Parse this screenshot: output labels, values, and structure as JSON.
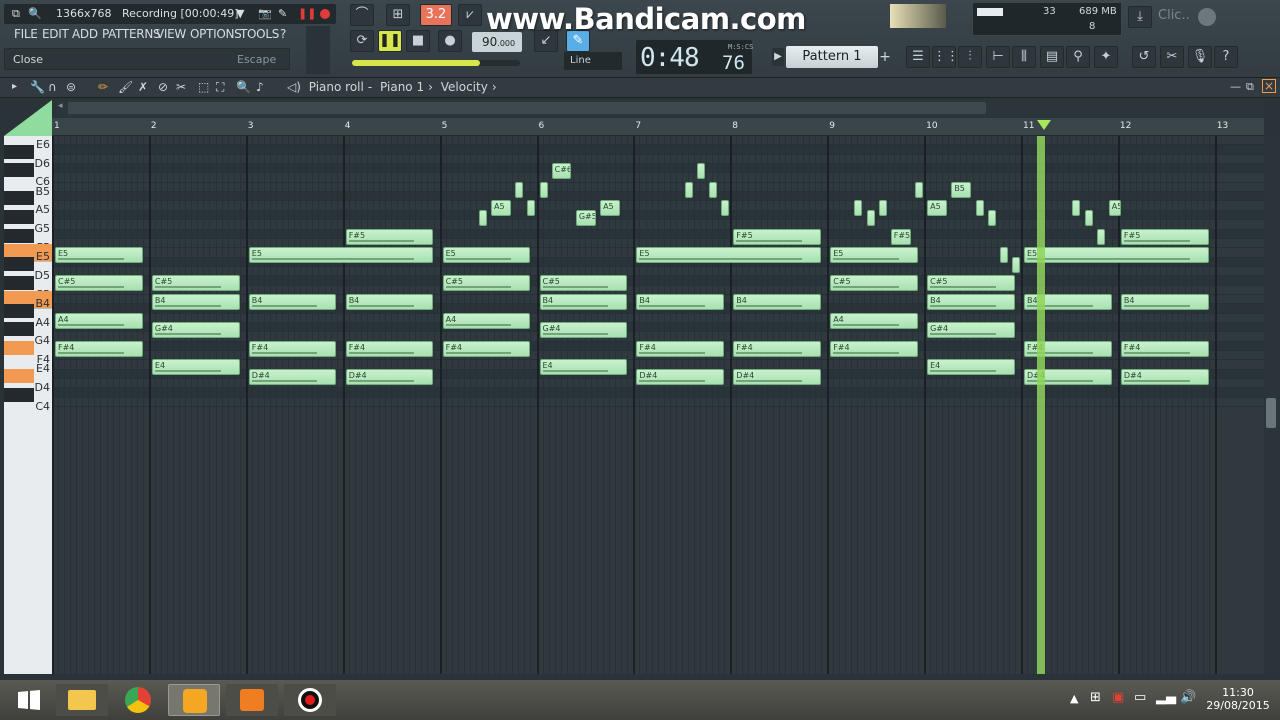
{
  "recorder": {
    "resolution": "1366x768",
    "status": "Recording [00:00:49]"
  },
  "watermark": "www.Bandicam.com",
  "menu": [
    "FILE",
    "EDIT",
    "ADD",
    "PATTERNS",
    "VIEW",
    "OPTIONS",
    "TOOLS",
    "?"
  ],
  "hint": {
    "left": "Close",
    "right": "Escape"
  },
  "transport": {
    "tempo_int": "90",
    "tempo_dec": ".000",
    "time_main": "0:48",
    "time_sub": "76",
    "time_label": "M:S:CS",
    "snap": "Line",
    "counter": "3.2"
  },
  "pattern": {
    "name": "Pattern 1"
  },
  "resources": {
    "cpu_num": "33",
    "memory": "689 MB",
    "polyphony": "8"
  },
  "clic_label": "Clic..",
  "piano_roll": {
    "crumbs": [
      "Piano roll",
      "Piano 1",
      "Velocity"
    ]
  },
  "ruler": [
    "1",
    "2",
    "3",
    "4",
    "5",
    "6",
    "7",
    "8",
    "9",
    "10",
    "11",
    "12",
    "13"
  ],
  "key_labels": [
    "E6",
    "D6",
    "C6",
    "B5",
    "A5",
    "G5",
    "F5",
    "E5",
    "D5",
    "C5",
    "B4",
    "A4",
    "G4",
    "F4",
    "E4",
    "D4",
    "C4"
  ],
  "notes": [
    {
      "label": "E5",
      "row": "E5",
      "bar": 1,
      "beat": 0,
      "len": 3.7
    },
    {
      "label": "C#5",
      "row": "C#5",
      "bar": 1,
      "beat": 0,
      "len": 3.7
    },
    {
      "label": "A4",
      "row": "A4",
      "bar": 1,
      "beat": 0,
      "len": 3.7
    },
    {
      "label": "F#4",
      "row": "F#4",
      "bar": 1,
      "beat": 0,
      "len": 3.7
    },
    {
      "label": "C#5",
      "row": "C#5",
      "bar": 2,
      "beat": 0,
      "len": 3.7
    },
    {
      "label": "B4",
      "row": "B4",
      "bar": 2,
      "beat": 0,
      "len": 3.7
    },
    {
      "label": "G#4",
      "row": "G#4",
      "bar": 2,
      "beat": 0,
      "len": 3.7
    },
    {
      "label": "E4",
      "row": "E4",
      "bar": 2,
      "beat": 0,
      "len": 3.7
    },
    {
      "label": "E5",
      "row": "E5",
      "bar": 3,
      "beat": 0,
      "len": 7.7
    },
    {
      "label": "B4",
      "row": "B4",
      "bar": 3,
      "beat": 0,
      "len": 3.7
    },
    {
      "label": "F#4",
      "row": "F#4",
      "bar": 3,
      "beat": 0,
      "len": 3.7
    },
    {
      "label": "D#4",
      "row": "D#4",
      "bar": 3,
      "beat": 0,
      "len": 3.7
    },
    {
      "label": "F#5",
      "row": "F#5",
      "bar": 4,
      "beat": 0,
      "len": 3.7
    },
    {
      "label": "B4",
      "row": "B4",
      "bar": 4,
      "beat": 0,
      "len": 3.7
    },
    {
      "label": "F#4",
      "row": "F#4",
      "bar": 4,
      "beat": 0,
      "len": 3.7
    },
    {
      "label": "D#4",
      "row": "D#4",
      "bar": 4,
      "beat": 0,
      "len": 3.7
    },
    {
      "label": "E5",
      "row": "E5",
      "bar": 5,
      "beat": 0,
      "len": 3.7
    },
    {
      "label": "C#5",
      "row": "C#5",
      "bar": 5,
      "beat": 0,
      "len": 3.7
    },
    {
      "label": "A4",
      "row": "A4",
      "bar": 5,
      "beat": 0,
      "len": 3.7
    },
    {
      "label": "F#4",
      "row": "F#4",
      "bar": 5,
      "beat": 0,
      "len": 3.7
    },
    {
      "label": "",
      "row": "G#5",
      "bar": 5,
      "beat": 1.5,
      "len": 0.4
    },
    {
      "label": "A5",
      "row": "A5",
      "bar": 5,
      "beat": 2,
      "len": 0.9
    },
    {
      "label": "",
      "row": "B5",
      "bar": 5,
      "beat": 3,
      "len": 0.4
    },
    {
      "label": "",
      "row": "A5",
      "bar": 5,
      "beat": 3.5,
      "len": 0.4
    },
    {
      "label": "",
      "row": "B5",
      "bar": 6,
      "beat": 0,
      "len": 0.4
    },
    {
      "label": "C#5",
      "row": "C#5",
      "bar": 6,
      "beat": 0,
      "len": 3.7
    },
    {
      "label": "B4",
      "row": "B4",
      "bar": 6,
      "beat": 0,
      "len": 3.7
    },
    {
      "label": "G#4",
      "row": "G#4",
      "bar": 6,
      "beat": 0,
      "len": 3.7
    },
    {
      "label": "E4",
      "row": "E4",
      "bar": 6,
      "beat": 0,
      "len": 3.7
    },
    {
      "label": "C#6",
      "row": "C#6",
      "bar": 6,
      "beat": 0.5,
      "len": 0.9
    },
    {
      "label": "G#5",
      "row": "G#5",
      "bar": 6,
      "beat": 1.5,
      "len": 0.9
    },
    {
      "label": "A5",
      "row": "A5",
      "bar": 6,
      "beat": 2.5,
      "len": 0.9
    },
    {
      "label": "E5",
      "row": "E5",
      "bar": 7,
      "beat": 0,
      "len": 7.7
    },
    {
      "label": "B4",
      "row": "B4",
      "bar": 7,
      "beat": 0,
      "len": 3.7
    },
    {
      "label": "F#4",
      "row": "F#4",
      "bar": 7,
      "beat": 0,
      "len": 3.7
    },
    {
      "label": "D#4",
      "row": "D#4",
      "bar": 7,
      "beat": 0,
      "len": 3.7
    },
    {
      "label": "",
      "row": "B5",
      "bar": 7,
      "beat": 2,
      "len": 0.4
    },
    {
      "label": "",
      "row": "C#6",
      "bar": 7,
      "beat": 2.5,
      "len": 0.4
    },
    {
      "label": "",
      "row": "B5",
      "bar": 7,
      "beat": 3,
      "len": 0.4
    },
    {
      "label": "",
      "row": "A5",
      "bar": 7,
      "beat": 3.5,
      "len": 0.4
    },
    {
      "label": "F#5",
      "row": "F#5",
      "bar": 8,
      "beat": 0,
      "len": 3.7
    },
    {
      "label": "B4",
      "row": "B4",
      "bar": 8,
      "beat": 0,
      "len": 3.7
    },
    {
      "label": "F#4",
      "row": "F#4",
      "bar": 8,
      "beat": 0,
      "len": 3.7
    },
    {
      "label": "D#4",
      "row": "D#4",
      "bar": 8,
      "beat": 0,
      "len": 3.7
    },
    {
      "label": "E5",
      "row": "E5",
      "bar": 9,
      "beat": 0,
      "len": 3.7
    },
    {
      "label": "C#5",
      "row": "C#5",
      "bar": 9,
      "beat": 0,
      "len": 3.7
    },
    {
      "label": "A4",
      "row": "A4",
      "bar": 9,
      "beat": 0,
      "len": 3.7
    },
    {
      "label": "F#4",
      "row": "F#4",
      "bar": 9,
      "beat": 0,
      "len": 3.7
    },
    {
      "label": "",
      "row": "A5",
      "bar": 9,
      "beat": 1,
      "len": 0.4
    },
    {
      "label": "",
      "row": "G#5",
      "bar": 9,
      "beat": 1.5,
      "len": 0.4
    },
    {
      "label": "",
      "row": "A5",
      "bar": 9,
      "beat": 2,
      "len": 0.4
    },
    {
      "label": "F#5",
      "row": "F#5",
      "bar": 9,
      "beat": 2.5,
      "len": 0.9
    },
    {
      "label": "",
      "row": "B5",
      "bar": 9,
      "beat": 3.5,
      "len": 0.4
    },
    {
      "label": "C#5",
      "row": "C#5",
      "bar": 10,
      "beat": 0,
      "len": 3.7
    },
    {
      "label": "B4",
      "row": "B4",
      "bar": 10,
      "beat": 0,
      "len": 3.7
    },
    {
      "label": "G#4",
      "row": "G#4",
      "bar": 10,
      "beat": 0,
      "len": 3.7
    },
    {
      "label": "E4",
      "row": "E4",
      "bar": 10,
      "beat": 0,
      "len": 3.7
    },
    {
      "label": "A5",
      "row": "A5",
      "bar": 10,
      "beat": 0,
      "len": 0.9
    },
    {
      "label": "B5",
      "row": "B5",
      "bar": 10,
      "beat": 1,
      "len": 0.9
    },
    {
      "label": "",
      "row": "A5",
      "bar": 10,
      "beat": 2,
      "len": 0.4
    },
    {
      "label": "",
      "row": "G#5",
      "bar": 10,
      "beat": 2.5,
      "len": 0.4
    },
    {
      "label": "",
      "row": "E5",
      "bar": 10,
      "beat": 3,
      "len": 0.4
    },
    {
      "label": "",
      "row": "D#5",
      "bar": 10,
      "beat": 3.5,
      "len": 0.4
    },
    {
      "label": "E5",
      "row": "E5",
      "bar": 11,
      "beat": 0,
      "len": 7.7
    },
    {
      "label": "B4",
      "row": "B4",
      "bar": 11,
      "beat": 0,
      "len": 3.7
    },
    {
      "label": "F#4",
      "row": "F#4",
      "bar": 11,
      "beat": 0,
      "len": 3.7
    },
    {
      "label": "D#4",
      "row": "D#4",
      "bar": 11,
      "beat": 0,
      "len": 3.7
    },
    {
      "label": "",
      "row": "A5",
      "bar": 11,
      "beat": 2,
      "len": 0.4
    },
    {
      "label": "",
      "row": "G#5",
      "bar": 11,
      "beat": 2.5,
      "len": 0.4
    },
    {
      "label": "",
      "row": "F#5",
      "bar": 11,
      "beat": 3,
      "len": 0.4
    },
    {
      "label": "A5",
      "row": "A5",
      "bar": 11,
      "beat": 3.5,
      "len": 0.6
    },
    {
      "label": "F#5",
      "row": "F#5",
      "bar": 12,
      "beat": 0,
      "len": 3.7
    },
    {
      "label": "B4",
      "row": "B4",
      "bar": 12,
      "beat": 0,
      "len": 3.7
    },
    {
      "label": "F#4",
      "row": "F#4",
      "bar": 12,
      "beat": 0,
      "len": 3.7
    },
    {
      "label": "D#4",
      "row": "D#4",
      "bar": 12,
      "beat": 0,
      "len": 3.7
    }
  ],
  "taskbar": {
    "time": "11:30",
    "date": "29/08/2015"
  },
  "colors": {
    "note": "#b8ebbf",
    "playhead": "#8fd35b",
    "accent": "#f39a52",
    "grid_bg": "#2f393e"
  }
}
